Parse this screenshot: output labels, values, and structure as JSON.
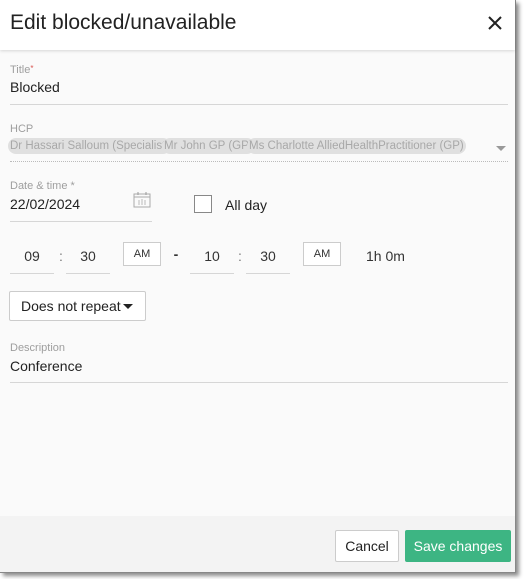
{
  "header": {
    "title": "Edit blocked/unavailable",
    "close_icon": "close-icon"
  },
  "title_field": {
    "label": "Title",
    "required_mark": "*",
    "value": "Blocked"
  },
  "hcp_field": {
    "label": "HCP",
    "chips": [
      "Dr Hassari Salloum (Specialist)",
      "Mr John GP (GP)",
      "Ms Charlotte AlliedHealthPractitioner (GP)"
    ],
    "dropdown_icon": "caret-down-icon"
  },
  "date_field": {
    "label": "Date & time *",
    "value": "22/02/2024",
    "icon": "calendar-icon"
  },
  "all_day": {
    "label": "All day",
    "checked": false
  },
  "time": {
    "start_hour": "09",
    "start_minute": "30",
    "start_ampm": "AM",
    "separator": ":",
    "dash": "-",
    "end_hour": "10",
    "end_minute": "30",
    "end_ampm": "AM",
    "duration": "1h 0m"
  },
  "repeat": {
    "selected": "Does not repeat"
  },
  "description_field": {
    "label": "Description",
    "value": "Conference"
  },
  "footer": {
    "cancel_label": "Cancel",
    "save_label": "Save changes"
  },
  "colors": {
    "accent": "#3db583",
    "required": "#d9534f"
  }
}
